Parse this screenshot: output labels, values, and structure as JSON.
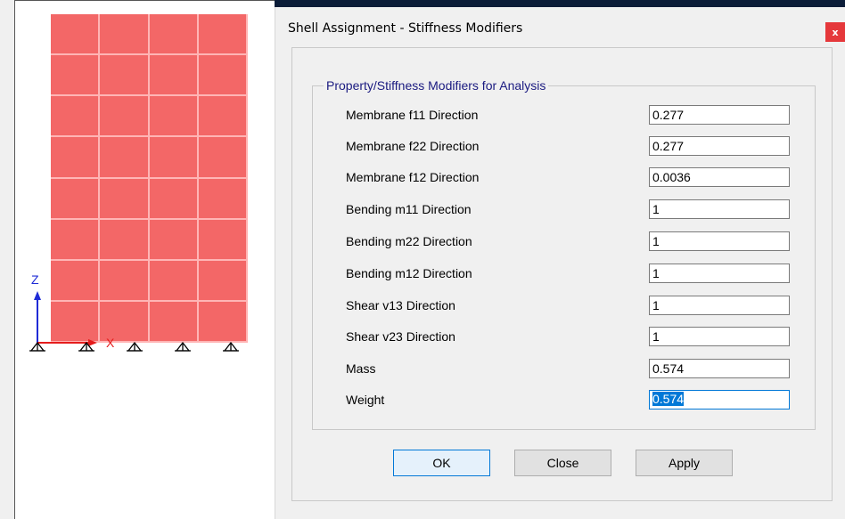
{
  "dialog": {
    "title": "Shell Assignment - Stiffness Modifiers",
    "close_label": "x",
    "group_title": "Property/Stiffness Modifiers for Analysis",
    "rows": [
      {
        "label": "Membrane f11 Direction",
        "value": "0.277"
      },
      {
        "label": "Membrane f22 Direction",
        "value": "0.277"
      },
      {
        "label": "Membrane f12 Direction",
        "value": "0.0036"
      },
      {
        "label": "Bending m11 Direction",
        "value": "1"
      },
      {
        "label": "Bending m22 Direction",
        "value": "1"
      },
      {
        "label": "Bending m12 Direction",
        "value": "1"
      },
      {
        "label": "Shear v13 Direction",
        "value": "1"
      },
      {
        "label": "Shear v23 Direction",
        "value": "1"
      },
      {
        "label": "Mass",
        "value": "0.574"
      },
      {
        "label": "Weight",
        "value": "0.574"
      }
    ],
    "buttons": {
      "ok": "OK",
      "close": "Close",
      "apply": "Apply"
    }
  },
  "viewport": {
    "axis_z_label": "Z",
    "axis_x_label": "X",
    "shell_color": "#f36767",
    "axis_z_color": "#1f2bd6",
    "axis_x_color": "#e51c1c"
  }
}
